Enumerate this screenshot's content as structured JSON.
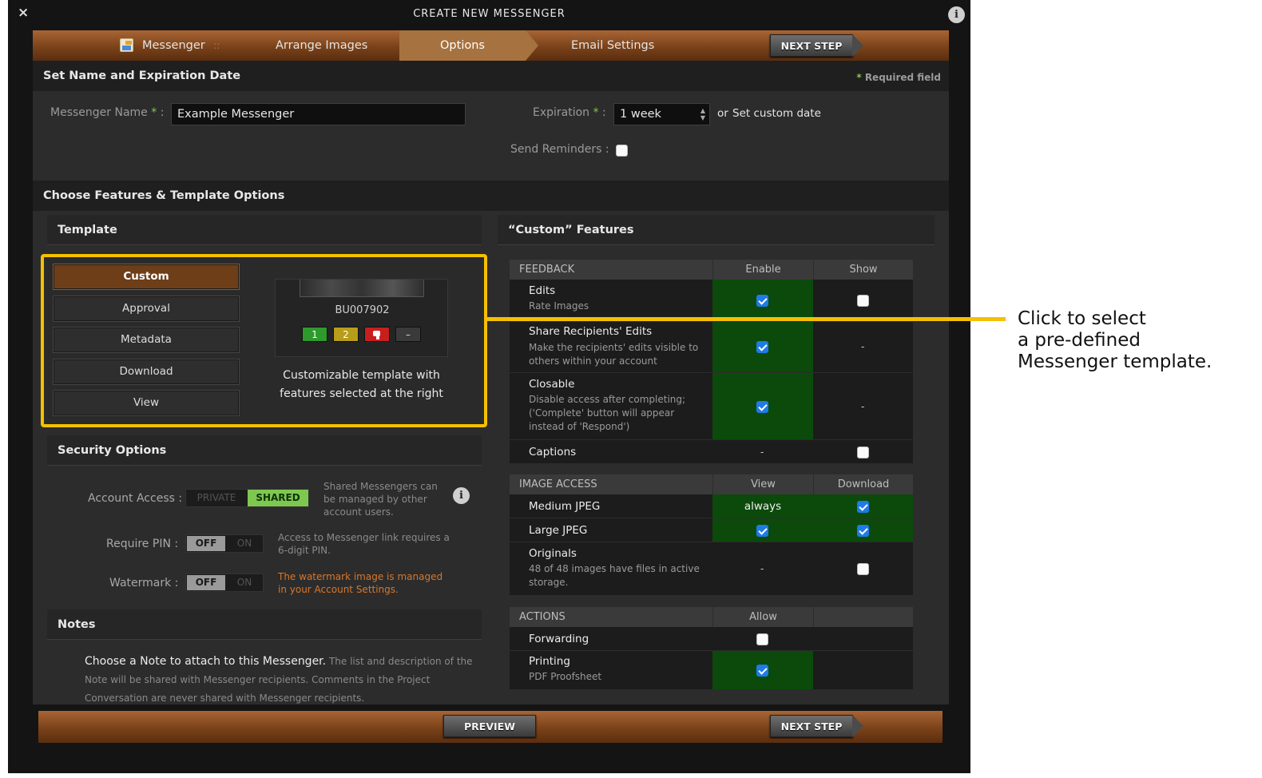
{
  "window": {
    "title": "CREATE NEW MESSENGER",
    "close_glyph": "×",
    "info_glyph": "i"
  },
  "steps": {
    "messenger": "Messenger",
    "separator": "::",
    "arrange": "Arrange Images",
    "options": "Options",
    "email": "Email Settings",
    "next": "NEXT STEP"
  },
  "name_section": {
    "title": "Set Name and Expiration Date",
    "required_star": "*",
    "required_note": "Required field",
    "name_label": "Messenger Name",
    "name_value": "Example Messenger",
    "expiration_label": "Expiration",
    "expiration_value": "1 week",
    "or_text": "or",
    "custom_date": "Set custom date",
    "reminders_label": "Send Reminders :",
    "colon": ":"
  },
  "features_section": {
    "title": "Choose Features & Template Options"
  },
  "template": {
    "title": "Template",
    "buttons": [
      "Custom",
      "Approval",
      "Metadata",
      "Download",
      "View"
    ],
    "selected": "Custom",
    "preview_id": "BU007902",
    "ratings": [
      "1",
      "2",
      "",
      "–"
    ],
    "description": "Customizable template with features selected at the right"
  },
  "security": {
    "title": "Security Options",
    "account_label": "Account Access :",
    "private": "PRIVATE",
    "shared": "SHARED",
    "account_help": "Shared Messengers can be managed by other account users.",
    "pin_label": "Require PIN :",
    "off": "OFF",
    "on": "ON",
    "pin_help": "Access to Messenger link requires a 6-digit PIN.",
    "watermark_label": "Watermark :",
    "watermark_help": "The watermark image is managed in your Account Settings."
  },
  "notes": {
    "title": "Notes",
    "lead": "Choose a Note to attach to this Messenger.",
    "body": "The list and description of the Note will be shared with Messenger recipients. Comments in the Project Conversation are never shared with Messenger recipients."
  },
  "custom_features": {
    "title_quoted": "“Custom”",
    "title_rest": "Features",
    "feedback": {
      "header": "FEEDBACK",
      "col1": "Enable",
      "col2": "Show"
    },
    "edits": {
      "name": "Edits",
      "desc": "Rate Images"
    },
    "share": {
      "name": "Share Recipients' Edits",
      "desc": "Make the recipients' edits visible to others within your account"
    },
    "closable": {
      "name": "Closable",
      "desc": "Disable access after completing; ('Complete' button will appear instead of 'Respond')"
    },
    "captions": {
      "name": "Captions"
    },
    "image_access": {
      "header": "IMAGE ACCESS",
      "col1": "View",
      "col2": "Download"
    },
    "medium": {
      "name": "Medium JPEG",
      "view": "always"
    },
    "large": {
      "name": "Large JPEG"
    },
    "originals": {
      "name": "Originals",
      "desc": "48 of 48 images have files in active storage."
    },
    "actions": {
      "header": "ACTIONS",
      "col1": "Allow"
    },
    "forwarding": {
      "name": "Forwarding"
    },
    "printing": {
      "name": "Printing",
      "desc": "PDF Proofsheet"
    },
    "dash": "-"
  },
  "bottom": {
    "preview": "PREVIEW",
    "next": "NEXT STEP"
  },
  "callout": {
    "line1": "Click to select",
    "line2": "a pre-defined",
    "line3": "Messenger template."
  },
  "colors": {
    "accent": "#f5c000",
    "bar": "#7a4219",
    "enabled": "#0b4a0b",
    "shared": "#7ec850"
  }
}
